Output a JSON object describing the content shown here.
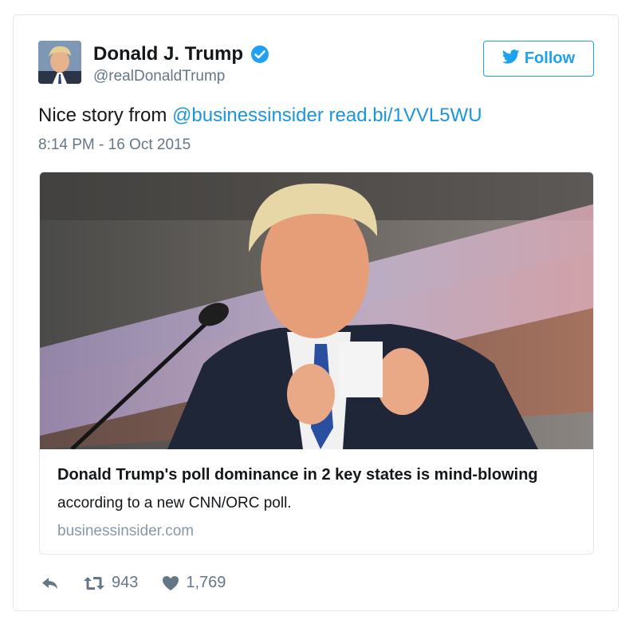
{
  "tweet": {
    "author": {
      "display_name": "Donald J. Trump",
      "handle": "@realDonaldTrump",
      "verified": true
    },
    "follow_label": "Follow",
    "text_prefix": "Nice story from ",
    "mention": "@businessinsider",
    "link": "read.bi/1VVL5WU",
    "timestamp": "8:14 PM - 16 Oct 2015",
    "card": {
      "title": "Donald Trump's poll dominance in 2 key states is mind-blowing",
      "description": "according to a new CNN/ORC poll.",
      "domain": "businessinsider.com"
    },
    "actions": {
      "retweets": "943",
      "likes": "1,769"
    }
  },
  "icons": {
    "verified": "verified-badge-icon",
    "follow": "twitter-bird-icon",
    "reply": "reply-icon",
    "retweet": "retweet-icon",
    "like": "heart-icon"
  },
  "colors": {
    "accent": "#1da1f2",
    "link": "#1b95e0",
    "secondary_text": "#657786",
    "border": "#e1e8ed"
  }
}
